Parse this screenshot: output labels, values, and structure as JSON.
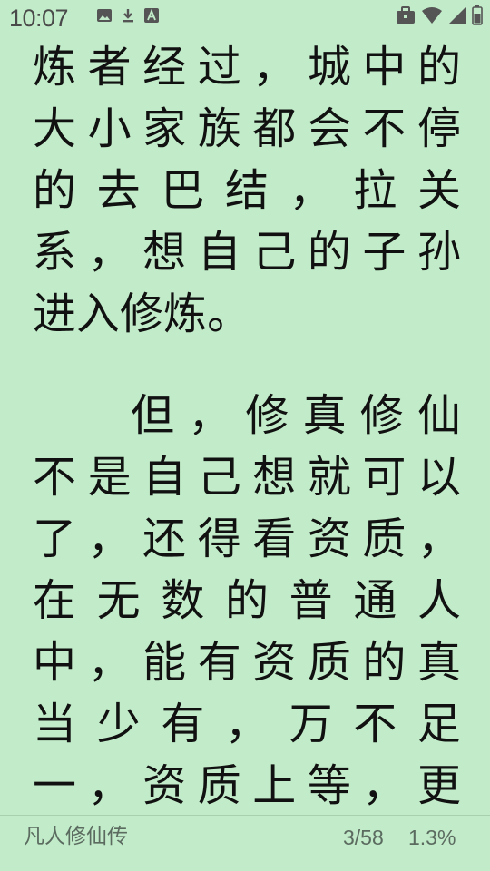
{
  "status_bar": {
    "time": "10:07",
    "left_icons": [
      "image-icon",
      "download-icon",
      "font-app-icon"
    ],
    "right_icons": [
      "briefcase-icon",
      "wifi-icon",
      "signal-icon",
      "battery-icon"
    ]
  },
  "reader": {
    "paragraphs": [
      {
        "lines": [
          "炼者经过，城中的",
          "大小家族都会不停",
          "的去巴结，拉关",
          "系，想自己的子孙",
          "进入修炼。"
        ]
      },
      {
        "lines": [
          "但，修真修仙",
          "不是自己想就可以",
          "了，还得看资质，",
          "在无数的普通人",
          "中，能有资质的真",
          "当少有，万不足",
          "一，资质上等，更"
        ]
      }
    ]
  },
  "footer": {
    "book_title": "凡人修仙传",
    "page": "3/58",
    "percent": "1.3%"
  },
  "colors": {
    "background": "#c2ecc9",
    "text": "#111111",
    "footer_text": "#5b6b60"
  }
}
